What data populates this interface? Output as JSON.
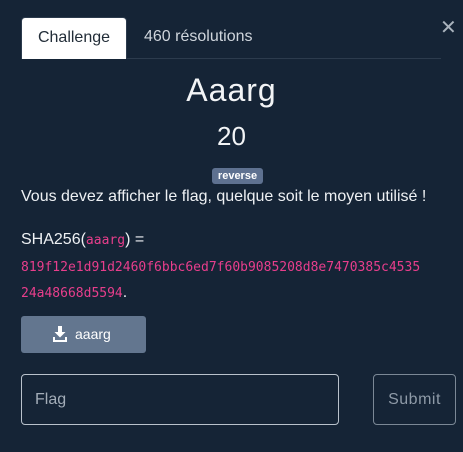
{
  "tabs": [
    {
      "label": "Challenge"
    },
    {
      "label": "460 résolutions"
    }
  ],
  "close_icon": "close-icon",
  "challenge": {
    "name": "Aaarg",
    "points": "20",
    "category": "reverse",
    "description": "Vous devez afficher le flag, quelque soit le moyen utilisé !",
    "sha_prefix": "SHA256(",
    "sha_file": "aaarg",
    "sha_mid": ") =",
    "hash_line1": "819f12e1d91d2460f6bbc6ed7f60b9085208d8e7470385c4535",
    "hash_line2": "24a48668d5594",
    "hash_end": "."
  },
  "download": {
    "label": "aaarg",
    "icon": "download-icon"
  },
  "flag_input": {
    "placeholder": "Flag",
    "value": ""
  },
  "submit": {
    "label": "Submit"
  }
}
